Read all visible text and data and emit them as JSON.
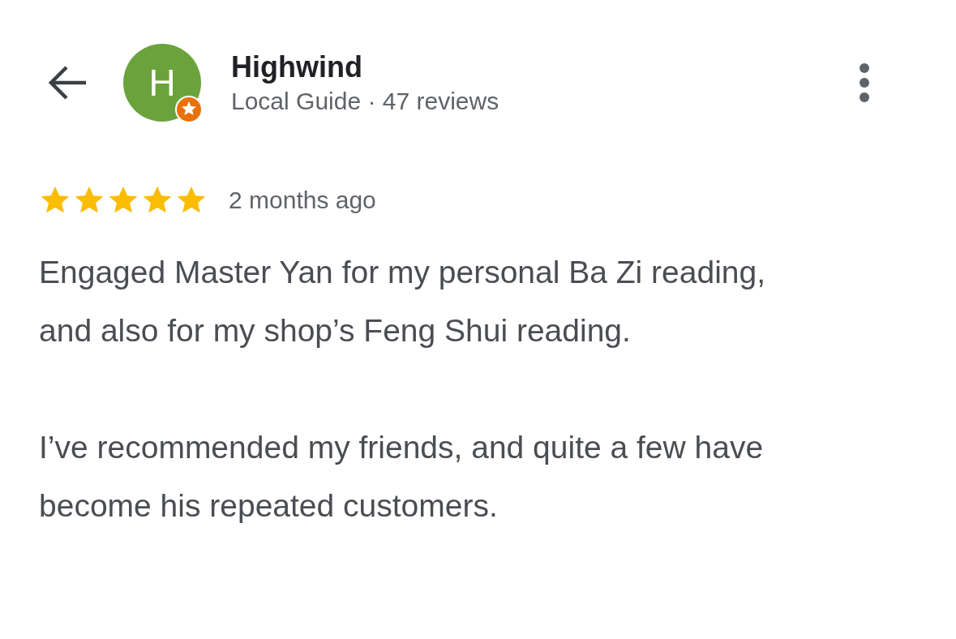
{
  "reviewer": {
    "avatar_letter": "H",
    "name": "Highwind",
    "badge": "Local Guide",
    "separator": "·",
    "reviews": "47 reviews",
    "local_guide": true
  },
  "review": {
    "stars": 5,
    "time": "2 months ago",
    "paragraphs": [
      "Engaged Master Yan for my personal Ba Zi reading, and also for my shop’s Feng Shui reading.",
      "I’ve recommended my friends, and quite a few have become his repeated customers."
    ]
  }
}
